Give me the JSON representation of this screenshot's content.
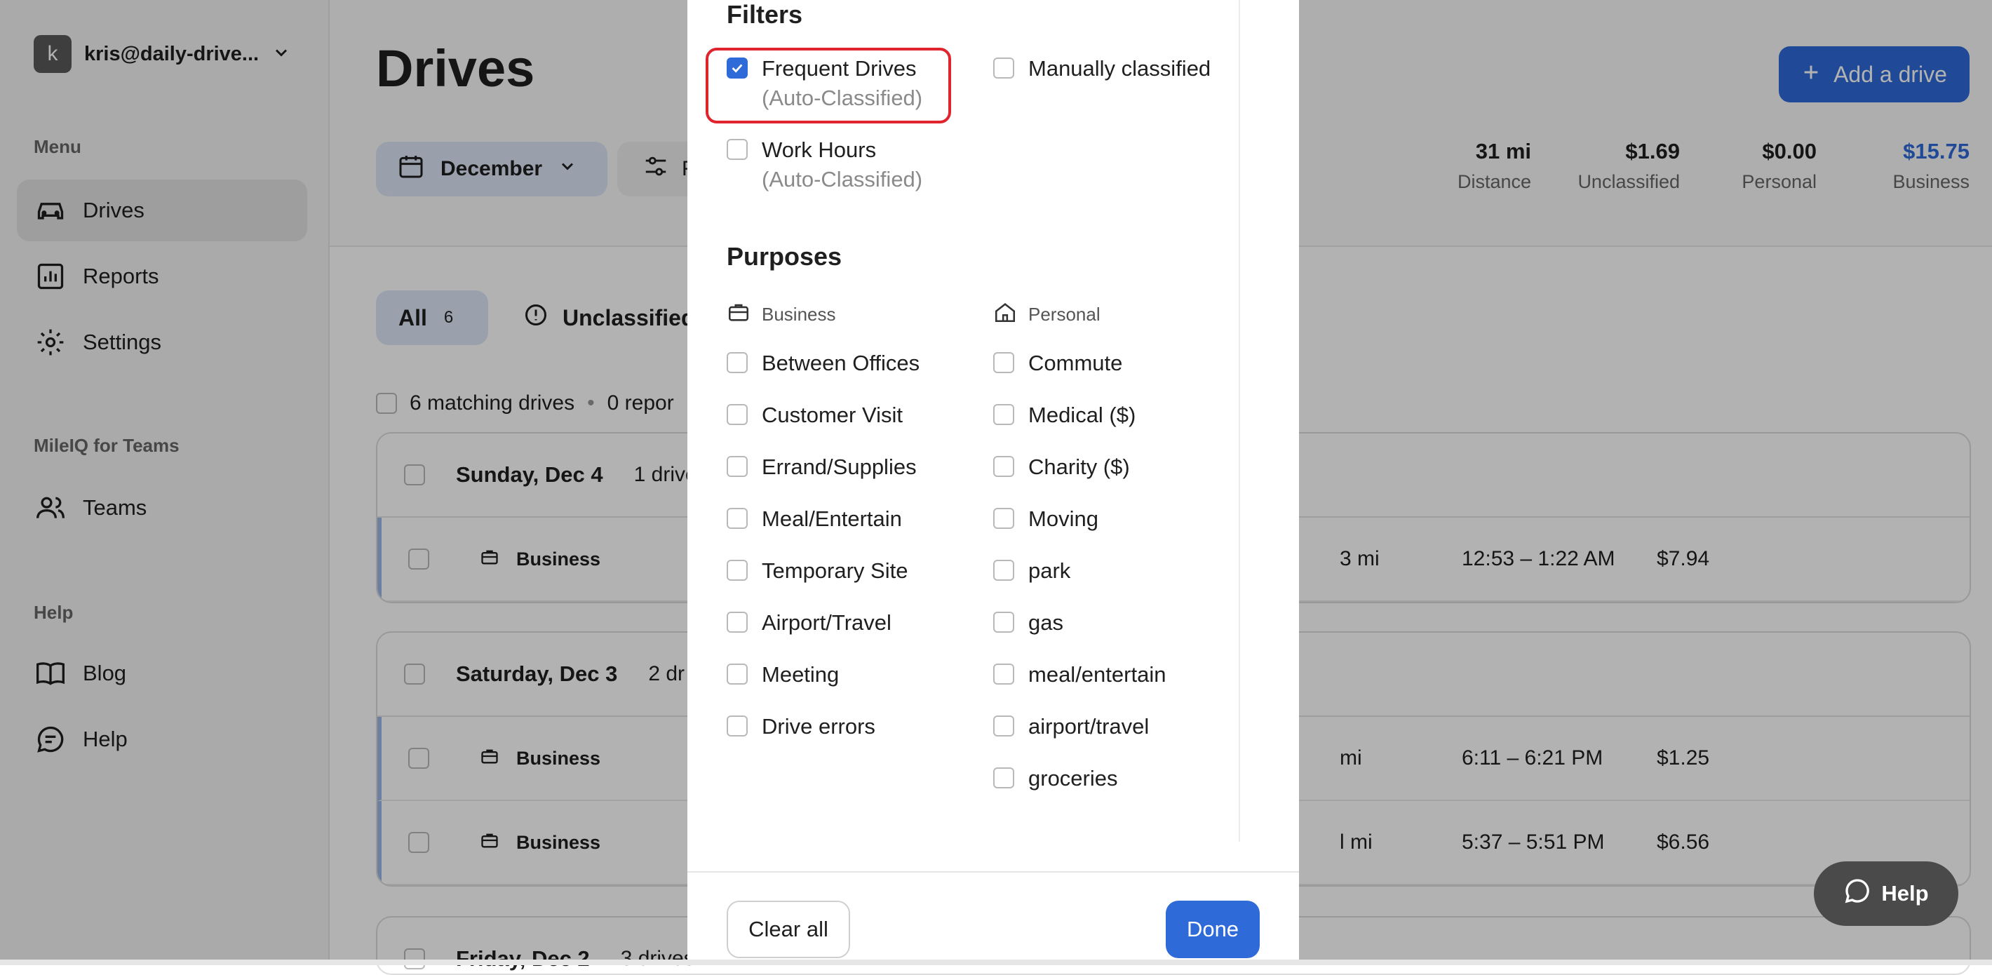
{
  "sidebar": {
    "avatar_letter": "k",
    "user_email": "kris@daily-drive...",
    "menu_label": "Menu",
    "items": [
      {
        "label": "Drives",
        "icon": "car-icon"
      },
      {
        "label": "Reports",
        "icon": "chart-icon"
      },
      {
        "label": "Settings",
        "icon": "gear-icon"
      }
    ],
    "teams_label": "MileIQ for Teams",
    "teams_item": "Teams",
    "help_label": "Help",
    "help_items": [
      {
        "label": "Blog",
        "icon": "book-icon"
      },
      {
        "label": "Help",
        "icon": "chat-icon"
      }
    ]
  },
  "header": {
    "title": "Drives",
    "month": "December",
    "filter_fragment": "F",
    "add_button": "Add a drive",
    "stats": [
      {
        "value": "31 mi",
        "label": "Distance"
      },
      {
        "value": "$1.69",
        "label": "Unclassified"
      },
      {
        "value": "$0.00",
        "label": "Personal"
      },
      {
        "value": "$15.75",
        "label": "Business"
      }
    ]
  },
  "tabs": {
    "all_label": "All",
    "all_count": "6",
    "unclassified_label": "Unclassified"
  },
  "summary": {
    "matching": "6 matching drives",
    "reported": "0 repor"
  },
  "drive_groups": [
    {
      "date": "Sunday, Dec 4",
      "count": "1 drive",
      "rows": [
        {
          "purpose": "Business",
          "distance": "3 mi",
          "time": "12:53 – 1:22 AM",
          "amount": "$7.94"
        }
      ]
    },
    {
      "date": "Saturday, Dec 3",
      "count": "2 dr",
      "rows": [
        {
          "purpose": "Business",
          "distance": "mi",
          "time": "6:11 – 6:21 PM",
          "amount": "$1.25"
        },
        {
          "purpose": "Business",
          "distance": "l mi",
          "time": "5:37 – 5:51 PM",
          "amount": "$6.56"
        }
      ]
    },
    {
      "date": "Friday, Dec 2",
      "count": "3 drives"
    }
  ],
  "modal": {
    "filters_title": "Filters",
    "filters": [
      {
        "label": "Frequent Drives",
        "sub": "(Auto-Classified)",
        "checked": true
      },
      {
        "label": "Manually classified",
        "checked": false
      },
      {
        "label": "Work Hours",
        "sub": "(Auto-Classified)",
        "checked": false
      }
    ],
    "purposes_title": "Purposes",
    "business_group": "Business",
    "personal_group": "Personal",
    "business_purposes": [
      "Between Offices",
      "Customer Visit",
      "Errand/Supplies",
      "Meal/Entertain",
      "Temporary Site",
      "Airport/Travel",
      "Meeting",
      "Drive errors"
    ],
    "personal_purposes": [
      "Commute",
      "Medical ($)",
      "Charity ($)",
      "Moving",
      "park",
      "gas",
      "meal/entertain",
      "airport/travel",
      "groceries"
    ],
    "clear_button": "Clear all",
    "done_button": "Done"
  },
  "help_fab": "Help",
  "colors": {
    "accent": "#2f6bd8",
    "highlight": "#e0242e",
    "overlay": "rgba(0,0,0,0.30)"
  }
}
